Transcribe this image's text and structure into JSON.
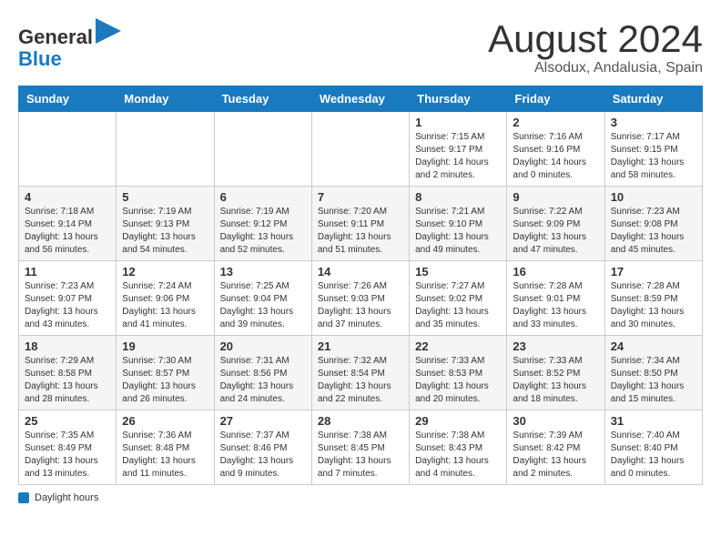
{
  "header": {
    "logo_line1": "General",
    "logo_line2": "Blue",
    "title": "August 2024",
    "subtitle": "Alsodux, Andalusia, Spain"
  },
  "calendar": {
    "days_of_week": [
      "Sunday",
      "Monday",
      "Tuesday",
      "Wednesday",
      "Thursday",
      "Friday",
      "Saturday"
    ],
    "weeks": [
      [
        {
          "day": "",
          "info": ""
        },
        {
          "day": "",
          "info": ""
        },
        {
          "day": "",
          "info": ""
        },
        {
          "day": "",
          "info": ""
        },
        {
          "day": "1",
          "info": "Sunrise: 7:15 AM\nSunset: 9:17 PM\nDaylight: 14 hours\nand 2 minutes."
        },
        {
          "day": "2",
          "info": "Sunrise: 7:16 AM\nSunset: 9:16 PM\nDaylight: 14 hours\nand 0 minutes."
        },
        {
          "day": "3",
          "info": "Sunrise: 7:17 AM\nSunset: 9:15 PM\nDaylight: 13 hours\nand 58 minutes."
        }
      ],
      [
        {
          "day": "4",
          "info": "Sunrise: 7:18 AM\nSunset: 9:14 PM\nDaylight: 13 hours\nand 56 minutes."
        },
        {
          "day": "5",
          "info": "Sunrise: 7:19 AM\nSunset: 9:13 PM\nDaylight: 13 hours\nand 54 minutes."
        },
        {
          "day": "6",
          "info": "Sunrise: 7:19 AM\nSunset: 9:12 PM\nDaylight: 13 hours\nand 52 minutes."
        },
        {
          "day": "7",
          "info": "Sunrise: 7:20 AM\nSunset: 9:11 PM\nDaylight: 13 hours\nand 51 minutes."
        },
        {
          "day": "8",
          "info": "Sunrise: 7:21 AM\nSunset: 9:10 PM\nDaylight: 13 hours\nand 49 minutes."
        },
        {
          "day": "9",
          "info": "Sunrise: 7:22 AM\nSunset: 9:09 PM\nDaylight: 13 hours\nand 47 minutes."
        },
        {
          "day": "10",
          "info": "Sunrise: 7:23 AM\nSunset: 9:08 PM\nDaylight: 13 hours\nand 45 minutes."
        }
      ],
      [
        {
          "day": "11",
          "info": "Sunrise: 7:23 AM\nSunset: 9:07 PM\nDaylight: 13 hours\nand 43 minutes."
        },
        {
          "day": "12",
          "info": "Sunrise: 7:24 AM\nSunset: 9:06 PM\nDaylight: 13 hours\nand 41 minutes."
        },
        {
          "day": "13",
          "info": "Sunrise: 7:25 AM\nSunset: 9:04 PM\nDaylight: 13 hours\nand 39 minutes."
        },
        {
          "day": "14",
          "info": "Sunrise: 7:26 AM\nSunset: 9:03 PM\nDaylight: 13 hours\nand 37 minutes."
        },
        {
          "day": "15",
          "info": "Sunrise: 7:27 AM\nSunset: 9:02 PM\nDaylight: 13 hours\nand 35 minutes."
        },
        {
          "day": "16",
          "info": "Sunrise: 7:28 AM\nSunset: 9:01 PM\nDaylight: 13 hours\nand 33 minutes."
        },
        {
          "day": "17",
          "info": "Sunrise: 7:28 AM\nSunset: 8:59 PM\nDaylight: 13 hours\nand 30 minutes."
        }
      ],
      [
        {
          "day": "18",
          "info": "Sunrise: 7:29 AM\nSunset: 8:58 PM\nDaylight: 13 hours\nand 28 minutes."
        },
        {
          "day": "19",
          "info": "Sunrise: 7:30 AM\nSunset: 8:57 PM\nDaylight: 13 hours\nand 26 minutes."
        },
        {
          "day": "20",
          "info": "Sunrise: 7:31 AM\nSunset: 8:56 PM\nDaylight: 13 hours\nand 24 minutes."
        },
        {
          "day": "21",
          "info": "Sunrise: 7:32 AM\nSunset: 8:54 PM\nDaylight: 13 hours\nand 22 minutes."
        },
        {
          "day": "22",
          "info": "Sunrise: 7:33 AM\nSunset: 8:53 PM\nDaylight: 13 hours\nand 20 minutes."
        },
        {
          "day": "23",
          "info": "Sunrise: 7:33 AM\nSunset: 8:52 PM\nDaylight: 13 hours\nand 18 minutes."
        },
        {
          "day": "24",
          "info": "Sunrise: 7:34 AM\nSunset: 8:50 PM\nDaylight: 13 hours\nand 15 minutes."
        }
      ],
      [
        {
          "day": "25",
          "info": "Sunrise: 7:35 AM\nSunset: 8:49 PM\nDaylight: 13 hours\nand 13 minutes."
        },
        {
          "day": "26",
          "info": "Sunrise: 7:36 AM\nSunset: 8:48 PM\nDaylight: 13 hours\nand 11 minutes."
        },
        {
          "day": "27",
          "info": "Sunrise: 7:37 AM\nSunset: 8:46 PM\nDaylight: 13 hours\nand 9 minutes."
        },
        {
          "day": "28",
          "info": "Sunrise: 7:38 AM\nSunset: 8:45 PM\nDaylight: 13 hours\nand 7 minutes."
        },
        {
          "day": "29",
          "info": "Sunrise: 7:38 AM\nSunset: 8:43 PM\nDaylight: 13 hours\nand 4 minutes."
        },
        {
          "day": "30",
          "info": "Sunrise: 7:39 AM\nSunset: 8:42 PM\nDaylight: 13 hours\nand 2 minutes."
        },
        {
          "day": "31",
          "info": "Sunrise: 7:40 AM\nSunset: 8:40 PM\nDaylight: 13 hours\nand 0 minutes."
        }
      ]
    ]
  },
  "footer": {
    "label": "Daylight hours"
  }
}
